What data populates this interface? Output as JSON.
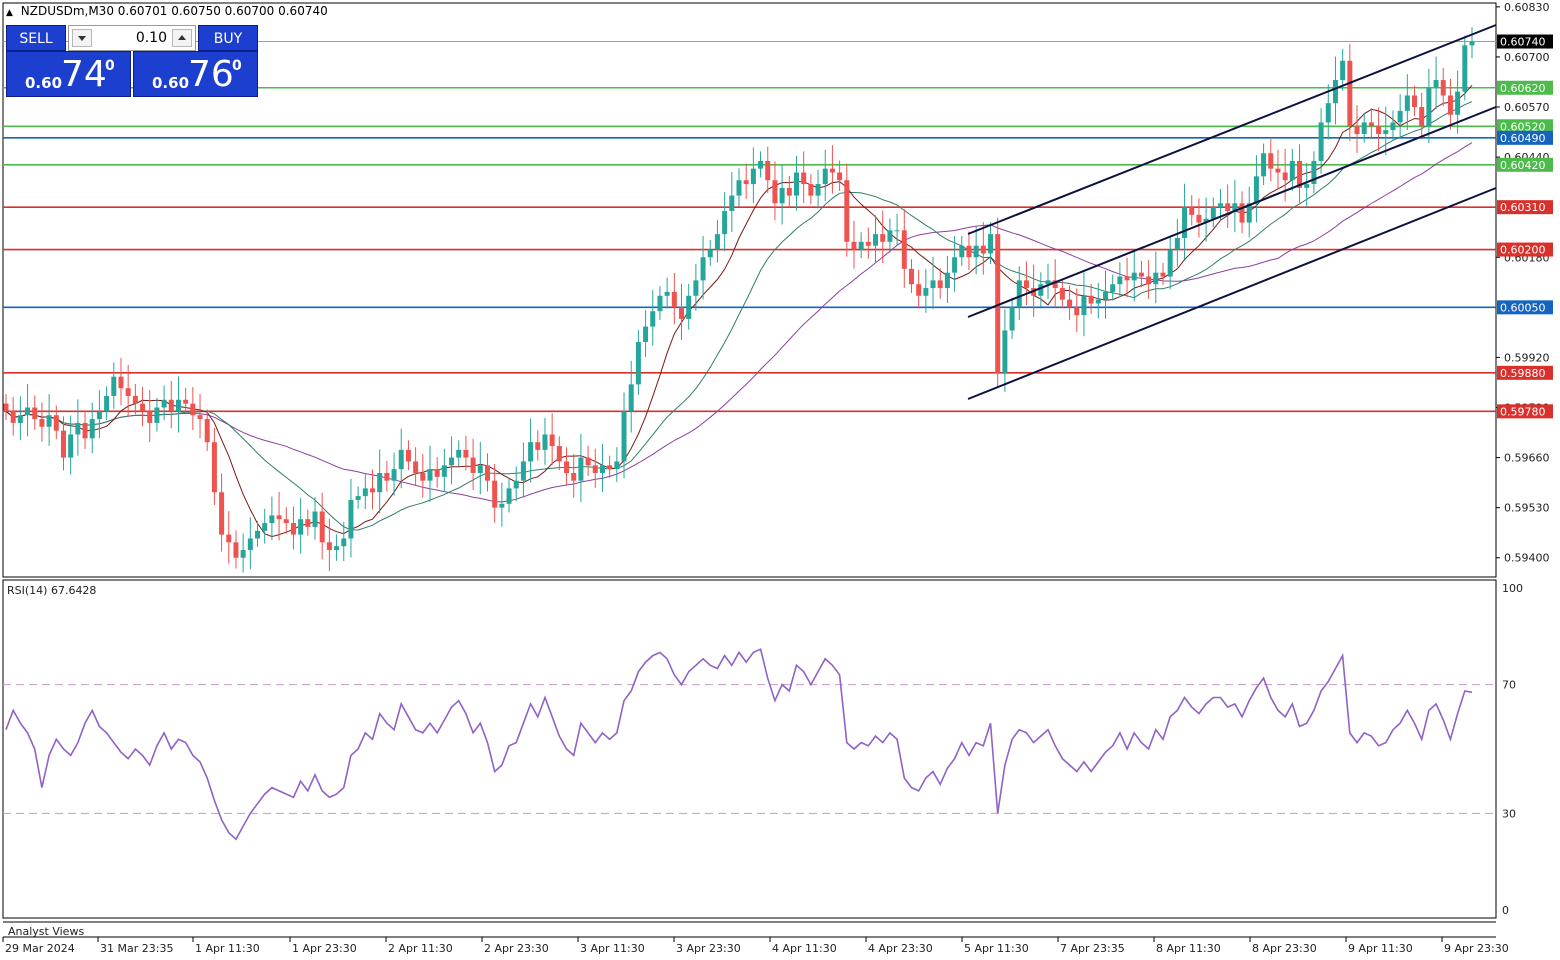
{
  "header": {
    "symbol": "NZDUSDm,M30",
    "ohlc": "0.60701 0.60750 0.60700 0.60740",
    "indicator_label": "RSI(14) 67.6428",
    "analyst_label": "Analyst Views"
  },
  "trade_panel": {
    "sell_label": "SELL",
    "buy_label": "BUY",
    "lot": "0.10",
    "sell_small": "0.60",
    "sell_big": "74",
    "sell_sup": "0",
    "buy_small": "0.60",
    "buy_big": "76",
    "buy_sup": "0"
  },
  "colors": {
    "bull": "#26a69a",
    "bear": "#ef5350",
    "support": "#4cbb4c",
    "resistance": "#d9302c",
    "pivot": "#1565c0",
    "channel": "#0d1340",
    "ma_fast": "#7b1a14",
    "ma_mid": "#2e7d6e",
    "ma_slow": "#8e3fa0",
    "rsi": "#8e62c6"
  },
  "chart_data": {
    "type": "candlestick",
    "timeframe": "M30",
    "ylim": [
      0.5935,
      0.6084
    ],
    "price_ticks": [
      "0.60830",
      "0.60700",
      "0.60570",
      "0.60440",
      "0.60180",
      "0.59920",
      "0.59790",
      "0.59660",
      "0.59530",
      "0.59400"
    ],
    "current_price": "0.60740",
    "x_labels": [
      "29 Mar 2024",
      "31 Mar 23:35",
      "1 Apr 11:30",
      "1 Apr 23:30",
      "2 Apr 11:30",
      "2 Apr 23:30",
      "3 Apr 11:30",
      "3 Apr 23:30",
      "4 Apr 11:30",
      "4 Apr 23:30",
      "5 Apr 11:30",
      "7 Apr 23:35",
      "8 Apr 11:30",
      "8 Apr 23:30",
      "9 Apr 11:30",
      "9 Apr 23:30"
    ],
    "levels": [
      {
        "value": 0.6062,
        "label": "0.60620",
        "kind": "support"
      },
      {
        "value": 0.6052,
        "label": "0.60520",
        "kind": "support"
      },
      {
        "value": 0.6049,
        "label": "0.60490",
        "kind": "pivot"
      },
      {
        "value": 0.6042,
        "label": "0.60420",
        "kind": "support"
      },
      {
        "value": 0.6031,
        "label": "0.60310",
        "kind": "resistance"
      },
      {
        "value": 0.602,
        "label": "0.60200",
        "kind": "resistance"
      },
      {
        "value": 0.6005,
        "label": "0.60050",
        "kind": "pivot"
      },
      {
        "value": 0.5988,
        "label": "0.59880",
        "kind": "resistance"
      },
      {
        "value": 0.5978,
        "label": "0.59780",
        "kind": "resistance"
      }
    ],
    "closes": [
      0.5978,
      0.5975,
      0.5977,
      0.5979,
      0.5976,
      0.5974,
      0.5977,
      0.5973,
      0.5966,
      0.5972,
      0.5975,
      0.5971,
      0.5976,
      0.5978,
      0.5982,
      0.5987,
      0.5984,
      0.5982,
      0.598,
      0.5978,
      0.5975,
      0.5979,
      0.5981,
      0.5978,
      0.5981,
      0.598,
      0.5977,
      0.5976,
      0.597,
      0.5957,
      0.5946,
      0.5944,
      0.594,
      0.5942,
      0.5945,
      0.5947,
      0.5949,
      0.5951,
      0.595,
      0.5949,
      0.5946,
      0.595,
      0.5948,
      0.5952,
      0.5944,
      0.5942,
      0.5943,
      0.5945,
      0.5955,
      0.5956,
      0.5958,
      0.5957,
      0.5962,
      0.596,
      0.5963,
      0.5968,
      0.5965,
      0.5962,
      0.596,
      0.5963,
      0.5961,
      0.5964,
      0.5966,
      0.5968,
      0.5966,
      0.5962,
      0.5964,
      0.596,
      0.5953,
      0.5954,
      0.5958,
      0.596,
      0.5965,
      0.597,
      0.5968,
      0.5972,
      0.5969,
      0.5965,
      0.5962,
      0.596,
      0.5966,
      0.5964,
      0.5962,
      0.5964,
      0.5963,
      0.5965,
      0.5978,
      0.5985,
      0.5996,
      0.6,
      0.6004,
      0.6008,
      0.6009,
      0.6005,
      0.6002,
      0.6008,
      0.6012,
      0.6018,
      0.602,
      0.6024,
      0.603,
      0.6034,
      0.6038,
      0.6037,
      0.6041,
      0.6043,
      0.6038,
      0.6032,
      0.6036,
      0.6034,
      0.604,
      0.6037,
      0.6034,
      0.6037,
      0.6041,
      0.604,
      0.6038,
      0.6022,
      0.602,
      0.6022,
      0.6021,
      0.6024,
      0.6022,
      0.6025,
      0.6025,
      0.6015,
      0.6011,
      0.6008,
      0.601,
      0.6012,
      0.601,
      0.6014,
      0.6018,
      0.6021,
      0.6018,
      0.6021,
      0.6019,
      0.6024,
      0.5988,
      0.5999,
      0.6005,
      0.6012,
      0.601,
      0.6008,
      0.6011,
      0.6012,
      0.601,
      0.6007,
      0.6005,
      0.6003,
      0.6008,
      0.6006,
      0.6007,
      0.6009,
      0.6011,
      0.6013,
      0.6012,
      0.6014,
      0.6013,
      0.6011,
      0.6014,
      0.6013,
      0.602,
      0.6023,
      0.6031,
      0.6029,
      0.6027,
      0.6028,
      0.6031,
      0.6032,
      0.603,
      0.6032,
      0.6027,
      0.6032,
      0.6039,
      0.6045,
      0.6041,
      0.604,
      0.6038,
      0.6043,
      0.6036,
      0.6037,
      0.6043,
      0.6053,
      0.6058,
      0.6064,
      0.6069,
      0.6052,
      0.605,
      0.6053,
      0.6052,
      0.605,
      0.6051,
      0.6053,
      0.6056,
      0.606,
      0.6057,
      0.6052,
      0.6062,
      0.6064,
      0.606,
      0.6055,
      0.6061,
      0.6073,
      0.6074
    ],
    "rsi": {
      "name": "RSI(14)",
      "value": "67.6428",
      "ylim": [
        0,
        100
      ],
      "levels": [
        70,
        30
      ],
      "ticks": [
        "100",
        "70",
        "30",
        "0"
      ],
      "values": [
        56,
        62,
        58,
        55,
        50,
        38,
        48,
        53,
        50,
        48,
        52,
        58,
        62,
        57,
        55,
        52,
        49,
        47,
        50,
        48,
        45,
        51,
        55,
        50,
        53,
        52,
        48,
        46,
        41,
        34,
        28,
        24,
        22,
        26,
        30,
        33,
        36,
        38,
        37,
        36,
        35,
        40,
        37,
        42,
        37,
        35,
        36,
        38,
        48,
        50,
        55,
        53,
        61,
        58,
        56,
        64,
        60,
        56,
        55,
        58,
        55,
        59,
        63,
        65,
        61,
        55,
        58,
        52,
        43,
        45,
        51,
        52,
        58,
        64,
        60,
        66,
        60,
        54,
        50,
        48,
        58,
        55,
        52,
        55,
        53,
        55,
        65,
        68,
        74,
        77,
        79,
        80,
        78,
        73,
        70,
        74,
        76,
        78,
        76,
        75,
        79,
        76,
        80,
        77,
        80,
        81,
        72,
        65,
        70,
        68,
        76,
        74,
        70,
        74,
        78,
        76,
        73,
        52,
        50,
        52,
        51,
        54,
        52,
        55,
        53,
        41,
        38,
        37,
        41,
        43,
        39,
        44,
        47,
        52,
        48,
        52,
        51,
        58,
        30,
        45,
        53,
        56,
        55,
        52,
        54,
        56,
        51,
        47,
        45,
        43,
        46,
        43,
        46,
        49,
        51,
        55,
        50,
        55,
        52,
        50,
        56,
        53,
        60,
        62,
        66,
        63,
        61,
        64,
        66,
        66,
        63,
        64,
        60,
        65,
        69,
        72,
        66,
        62,
        60,
        64,
        57,
        58,
        62,
        68,
        71,
        75,
        79,
        55,
        52,
        55,
        54,
        51,
        52,
        56,
        58,
        62,
        58,
        53,
        62,
        64,
        59,
        53,
        61,
        68,
        67.6
      ]
    }
  }
}
